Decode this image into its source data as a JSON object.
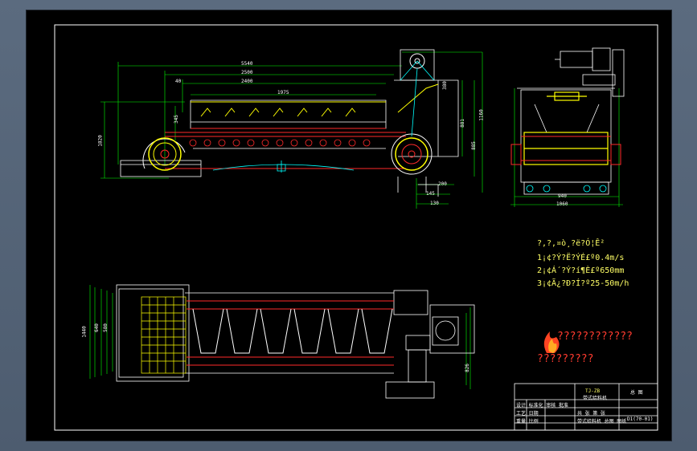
{
  "dimensions": {
    "d5540": "5540",
    "d2500": "2500",
    "d2400": "2400",
    "d1975": "1975",
    "d40": "40",
    "d1160": "1160",
    "d881": "881",
    "d885": "885",
    "d1820": "1820",
    "d345": "345",
    "d200": "200",
    "d145": "145",
    "d8_130": "130",
    "d380": "380",
    "d580": "580",
    "d640": "640",
    "d940": "940",
    "d1060": "1060",
    "d826": "826",
    "d1440": "1440"
  },
  "specs": [
    "?,?,¤ò¸?ë?Ó¦Ê²",
    "1¡¢?Ý?Ë?ÝÉ£º0.4m/s",
    "2¡¢Á´?Ý?í¶È£º650mm",
    "3¡¢Ã¿?Ð?Í?º25-50m/h"
  ],
  "logo": {
    "top_text": "????????????",
    "bottom_text": "?????????"
  },
  "title_block": {
    "drawing_no": "TJ-ZB",
    "title": "带式给料机",
    "sheet_label": "总 图",
    "code": "D1(70-01)",
    "row1": "设计 标准化 审核 批准",
    "row2": "工艺 日期",
    "row3": "重量 比例",
    "mid": "共 张 第 张",
    "sub": "带式给料机 总图 图纸"
  },
  "colors": {
    "frame": "#ffffff",
    "main": "#ffff00",
    "red": "#ff2a2a",
    "cyan": "#00ffff",
    "green": "#00ff00",
    "white": "#ffffff"
  }
}
